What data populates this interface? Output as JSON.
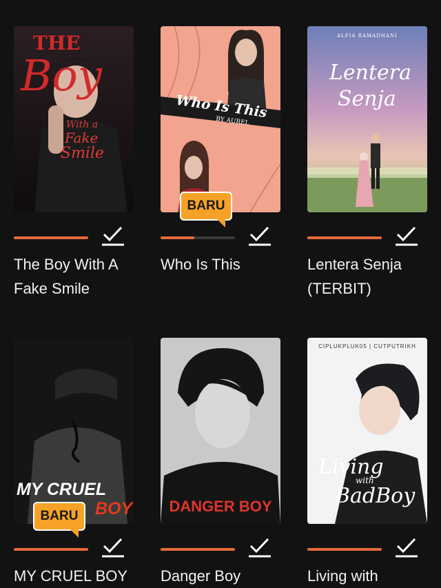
{
  "books": [
    {
      "title": "The Boy With A Fake Smile",
      "cover_title_top": "THE",
      "cover_title_main": "Boy",
      "cover_subtitle_1": "With a",
      "cover_subtitle_2": "Fake",
      "cover_subtitle_3": "Smile",
      "progress": 1.0,
      "badge": null
    },
    {
      "title": "Who Is This",
      "cover_title": "Who Is This",
      "cover_author": "BY AUREL",
      "progress": 0.45,
      "badge": "BARU"
    },
    {
      "title": "Lentera Senja (TERBIT)",
      "cover_title_1": "Lentera",
      "cover_title_2": "Senja",
      "progress": 1.0,
      "badge": null
    },
    {
      "title": "MY CRUEL BOY",
      "cover_title_1": "MY CRUEL",
      "cover_title_2": "BOY",
      "progress": 1.0,
      "badge": "BARU"
    },
    {
      "title": "Danger Boy",
      "cover_title": "DANGER BOY",
      "progress": 1.0,
      "badge": null
    },
    {
      "title": "Living with",
      "cover_header": "CIPLUKPLUK05 | CUTPUTRIKH",
      "cover_title_1": "Living",
      "cover_title_2": "with",
      "cover_title_3": "BadBoy",
      "progress": 1.0,
      "badge": null
    }
  ],
  "colors": {
    "background": "#121212",
    "progress": "#e8693a",
    "badge": "#f6a227",
    "text": "#f2f2f2"
  },
  "icons": {
    "check": "checkmark-icon"
  }
}
